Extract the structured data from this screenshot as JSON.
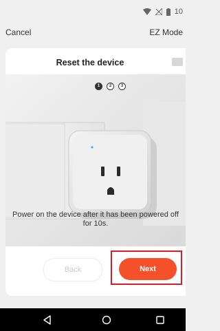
{
  "status_bar": {
    "time": "10",
    "icons": [
      "wifi-icon",
      "signal-icon",
      "battery-icon"
    ]
  },
  "top_nav": {
    "cancel_label": "Cancel",
    "mode_label": "EZ Mode"
  },
  "card": {
    "title": "Reset the device",
    "steps": [
      "1",
      "2",
      "3"
    ],
    "active_step": 1,
    "caption": "Power on the device after it has been powered off for 10s."
  },
  "buttons": {
    "back_label": "Back",
    "next_label": "Next"
  },
  "colors": {
    "accent": "#f4512a",
    "highlight": "#d81d26"
  }
}
